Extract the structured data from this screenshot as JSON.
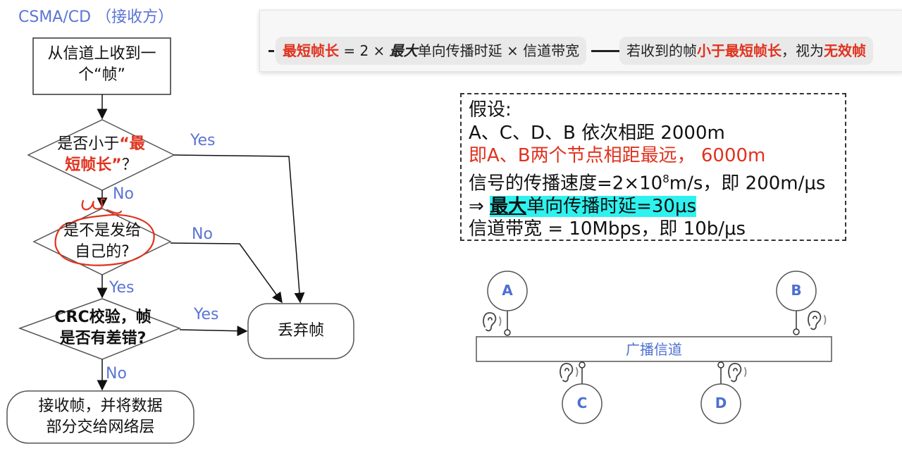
{
  "title": "CSMA/CD （接收方）",
  "flowchart": {
    "start": [
      "从信道上收到一",
      "个“帧”"
    ],
    "decision1": {
      "pre": "是否小于",
      "red_a": "“最",
      "red_b": "短帧长”",
      "post": "？"
    },
    "decision2": [
      "是不是发给",
      "自己的?"
    ],
    "decision3": [
      "CRC校验，帧",
      "是否有差错?"
    ],
    "end_accept": [
      "接收帧，并将数据",
      "部分交给网络层"
    ],
    "end_discard": "丢弃帧",
    "labels": {
      "yes1": "Yes",
      "no1": "No",
      "no2": "No",
      "yes2": "Yes",
      "yes3": "Yes",
      "no3": "No"
    }
  },
  "formula": {
    "part1_red": "最短帧长",
    "part1_eq": " = 2 × ",
    "part1_bold": "最大",
    "part1_rest": "单向传播时延 × 信道带宽",
    "part2_pre": "若收到的帧",
    "part2_red1": "小于最短帧长",
    "part2_mid": "，视为",
    "part2_red2": "无效帧"
  },
  "assumptions": {
    "line1": "假设:",
    "line2": "A、C、D、B 依次相距 2000m",
    "line3": "即A、B两个节点相距最远， 6000m",
    "line4_pre": "信号的传播速度=2×10",
    "line4_sup": "8",
    "line4_post": "m/s，即 200m/μs",
    "line5_arrow": "⇒ ",
    "line5_bold": "最大",
    "line5_rest": "单向传播时延=30μs",
    "line6": "信道带宽 = 10Mbps，即 10b/μs"
  },
  "network": {
    "nodes": [
      "A",
      "B",
      "C",
      "D"
    ],
    "channel": "广播信道"
  },
  "colors": {
    "accent_blue": "#5b74d4",
    "red": "#e0321e",
    "highlight": "#2ef2ef",
    "annotation": "#e0321e"
  }
}
